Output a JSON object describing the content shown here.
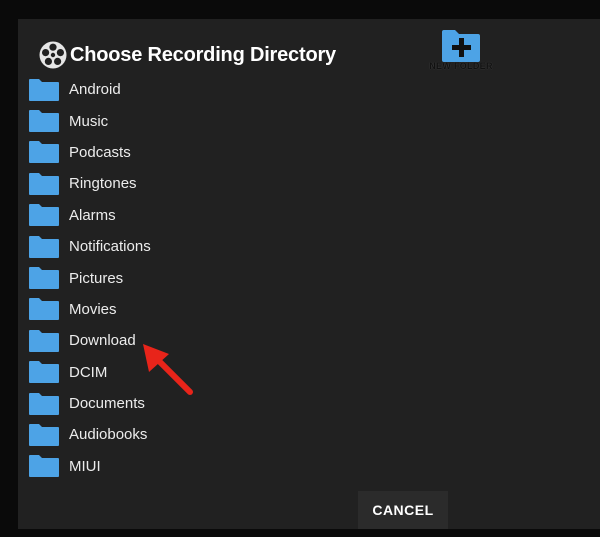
{
  "dialog": {
    "title": "Choose Recording Directory",
    "title_icon": "film-reel-icon",
    "new_folder_label": "NEW FOLDER",
    "new_folder_icon": "folder-plus-icon",
    "cancel_label": "CANCEL"
  },
  "folders": [
    {
      "name": "Android"
    },
    {
      "name": "Music"
    },
    {
      "name": "Podcasts"
    },
    {
      "name": "Ringtones"
    },
    {
      "name": "Alarms"
    },
    {
      "name": "Notifications"
    },
    {
      "name": "Pictures"
    },
    {
      "name": "Movies"
    },
    {
      "name": "Download"
    },
    {
      "name": "DCIM"
    },
    {
      "name": "Documents"
    },
    {
      "name": "Audiobooks"
    },
    {
      "name": "MIUI"
    }
  ],
  "annotation": {
    "arrow_icon": "red-arrow-annotation",
    "arrow_color": "#e8241a",
    "points_to": "Download"
  },
  "colors": {
    "folder_blue": "#4da3e6",
    "dialog_bg": "#212121",
    "page_bg": "#0a0a0a"
  }
}
